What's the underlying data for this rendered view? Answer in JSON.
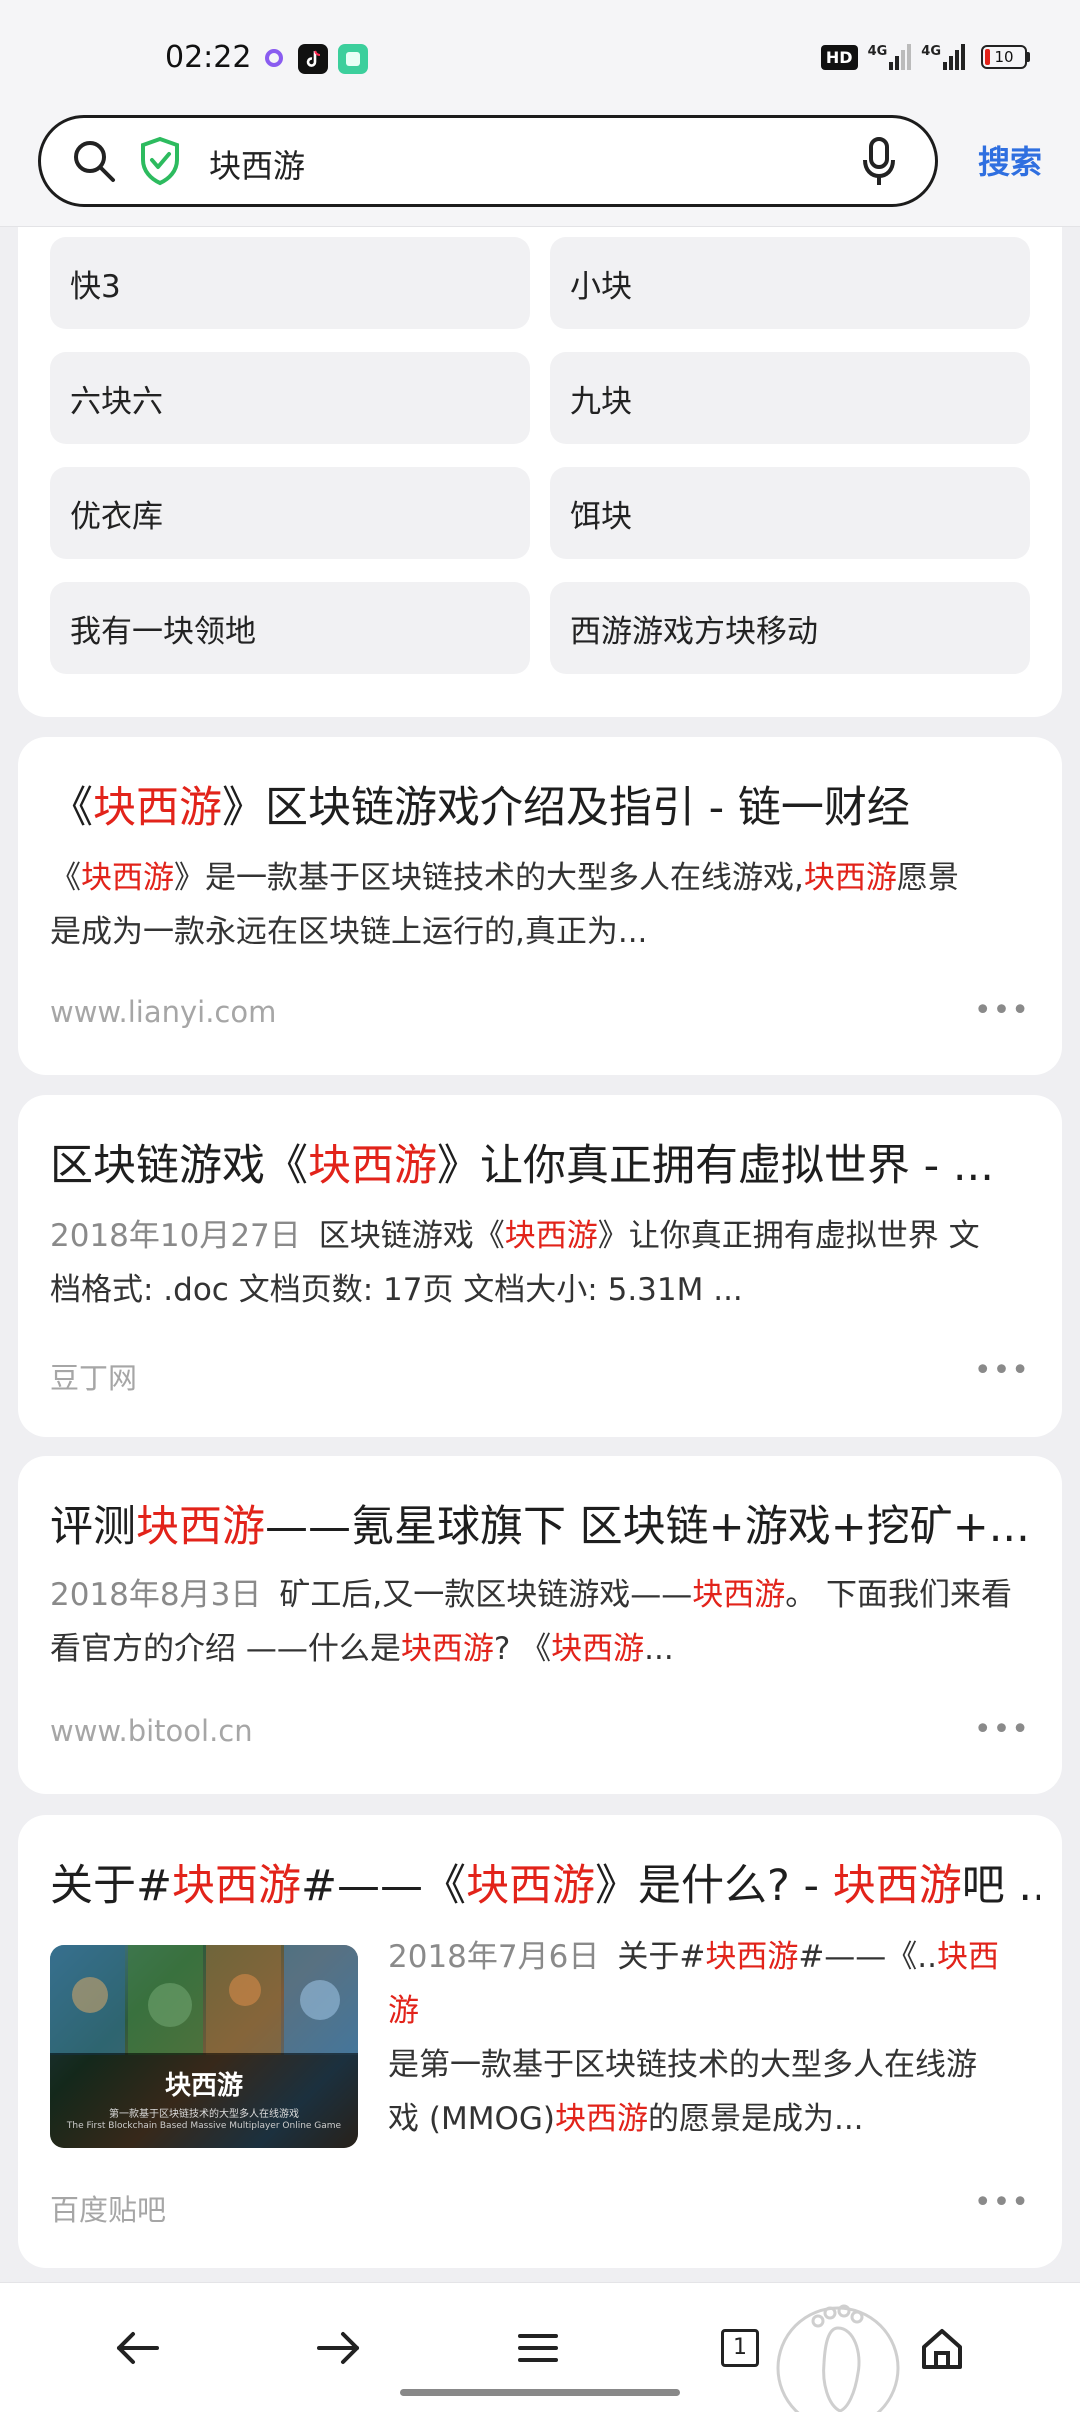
{
  "status_bar": {
    "time": "02:22",
    "battery": "10",
    "hd_label": "HD",
    "network_1": "4G",
    "network_2": "4G"
  },
  "search": {
    "query": "块西游",
    "button_label": "搜索"
  },
  "suggestions": [
    "快3",
    "小块",
    "六块六",
    "九块",
    "优衣库",
    "饵块",
    "我有一块领地",
    "西游游戏方块移动"
  ],
  "results": [
    {
      "title_pre": "《",
      "title_hl": "块西游",
      "title_post": "》区块链游戏介绍及指引 - 链一财经",
      "snippet_line1_a": "《",
      "snippet_line1_hl1": "块西游",
      "snippet_line1_b": "》是一款基于区块链技术的大型多人在线游戏,",
      "snippet_line1_hl2": "块西游",
      "snippet_line1_c": "愿景",
      "snippet_line2": "是成为一款永远在区块链上运行的,真正为...",
      "source": "www.lianyi.com",
      "more": "•••"
    },
    {
      "title_pre": "区块链游戏《",
      "title_hl": "块西游",
      "title_post": "》让你真正拥有虚拟世界 - ...",
      "date": "2018年10月27日",
      "snippet_a": "区块链游戏《",
      "snippet_hl": "块西游",
      "snippet_b": "》让你真正拥有虚拟世界 文",
      "snippet_line2": "档格式: .doc 文档页数: 17页 文档大小: 5.31M ...",
      "source": "豆丁网",
      "more": "•••"
    },
    {
      "title_pre": "评测",
      "title_hl": "块西游",
      "title_post": "——氪星球旗下 区块链+游戏+挖矿+...",
      "date": "2018年8月3日",
      "snippet_a": "矿工后,又一款区块链游戏——",
      "snippet_hl": "块西游",
      "snippet_b": "。 下面我们来看",
      "snippet_line2_a": "看官方的介绍 ——什么是",
      "snippet_line2_hl1": "块西游",
      "snippet_line2_b": "? 《",
      "snippet_line2_hl2": "块西游",
      "snippet_line2_c": "...",
      "source": "www.bitool.cn",
      "more": "•••"
    },
    {
      "title_a": "关于#",
      "title_hl1": "块西游",
      "title_b": "#——《",
      "title_hl2": "块西游",
      "title_c": "》是什么? - ",
      "title_hl3": "块西游",
      "title_d": "吧 ...",
      "date": "2018年7月6日",
      "snippet_a": "关于#",
      "snippet_hl1": "块西游",
      "snippet_b": "#——《..",
      "snippet_hl2": "块西游",
      "snippet_line2": "是第一款基于区块链技术的大型多人在线游",
      "snippet_line3_a": "戏 (MMOG)",
      "snippet_line3_hl": "块西游",
      "snippet_line3_b": "的愿景是成为...",
      "thumb_title": "块西游",
      "thumb_sub": "第一款基于区块链技术的大型多人在线游戏",
      "thumb_sub2": "The First Blockchain Based Massive Multiplayer Online Game",
      "source": "百度贴吧",
      "more": "•••"
    }
  ],
  "nav": {
    "tab_count": "1"
  }
}
